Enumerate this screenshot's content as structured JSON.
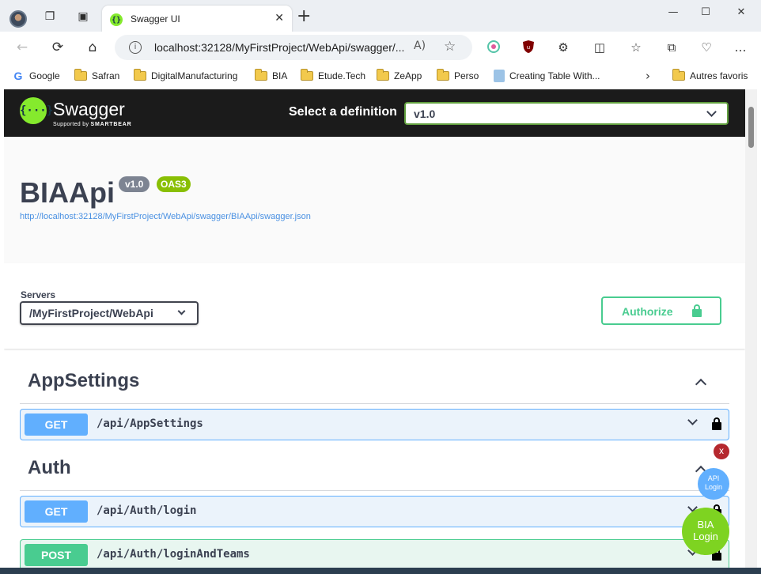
{
  "browser": {
    "tab": {
      "title": "Swagger UI",
      "close": "✕"
    },
    "new_tab": "+",
    "window_controls": {
      "minimize": "—",
      "maximize": "☐",
      "close": "✕"
    },
    "address_bar": {
      "url": "localhost:32128/MyFirstProject/WebApi/swagger/...",
      "readaloud": "A)",
      "favorite": "☆"
    },
    "nav": {
      "back": "←",
      "refresh": "⟳",
      "home": "⌂",
      "more": "…"
    },
    "favorites": [
      {
        "label": "Google",
        "icon": "google-icon"
      },
      {
        "label": "Safran",
        "icon": "folder-icon"
      },
      {
        "label": "DigitalManufacturing",
        "icon": "folder-icon"
      },
      {
        "label": "BIA",
        "icon": "folder-icon"
      },
      {
        "label": "Etude.Tech",
        "icon": "folder-icon"
      },
      {
        "label": "ZeApp",
        "icon": "folder-icon"
      },
      {
        "label": "Perso",
        "icon": "folder-icon"
      },
      {
        "label": "Creating Table With...",
        "icon": "page-icon"
      },
      {
        "label": "Autres favoris",
        "icon": "folder-icon"
      }
    ],
    "favorites_more": "›"
  },
  "swagger": {
    "logo_text": "Swagger",
    "logo_sub_prefix": "Supported by",
    "logo_sub_brand": "SMARTBEAR",
    "logo_glyph": "{···}",
    "definition_label": "Select a definition",
    "definition_value": "v1.0",
    "api_title": "BIAApi",
    "version_badge": "v1.0",
    "oas_badge": "OAS3",
    "spec_url": "http://localhost:32128/MyFirstProject/WebApi/swagger/BIAApi/swagger.json",
    "servers_label": "Servers",
    "servers_value": "/MyFirstProject/WebApi",
    "authorize_label": "Authorize",
    "tags": [
      {
        "name": "AppSettings",
        "operations": [
          {
            "method": "GET",
            "path": "/api/AppSettings"
          }
        ]
      },
      {
        "name": "Auth",
        "operations": [
          {
            "method": "GET",
            "path": "/api/Auth/login"
          },
          {
            "method": "POST",
            "path": "/api/Auth/loginAndTeams"
          }
        ]
      }
    ]
  },
  "widgets": {
    "close_label": "x",
    "api_login_line1": "API",
    "api_login_line2": "Login",
    "bia_login_line1": "BIA",
    "bia_login_line2": "Login"
  },
  "colors": {
    "get": "#61affe",
    "post": "#49cc90",
    "swagger_green": "#85ea2d",
    "topbar": "#1b1b1b",
    "oas_badge": "#89bf04",
    "version_badge": "#7d8492"
  }
}
